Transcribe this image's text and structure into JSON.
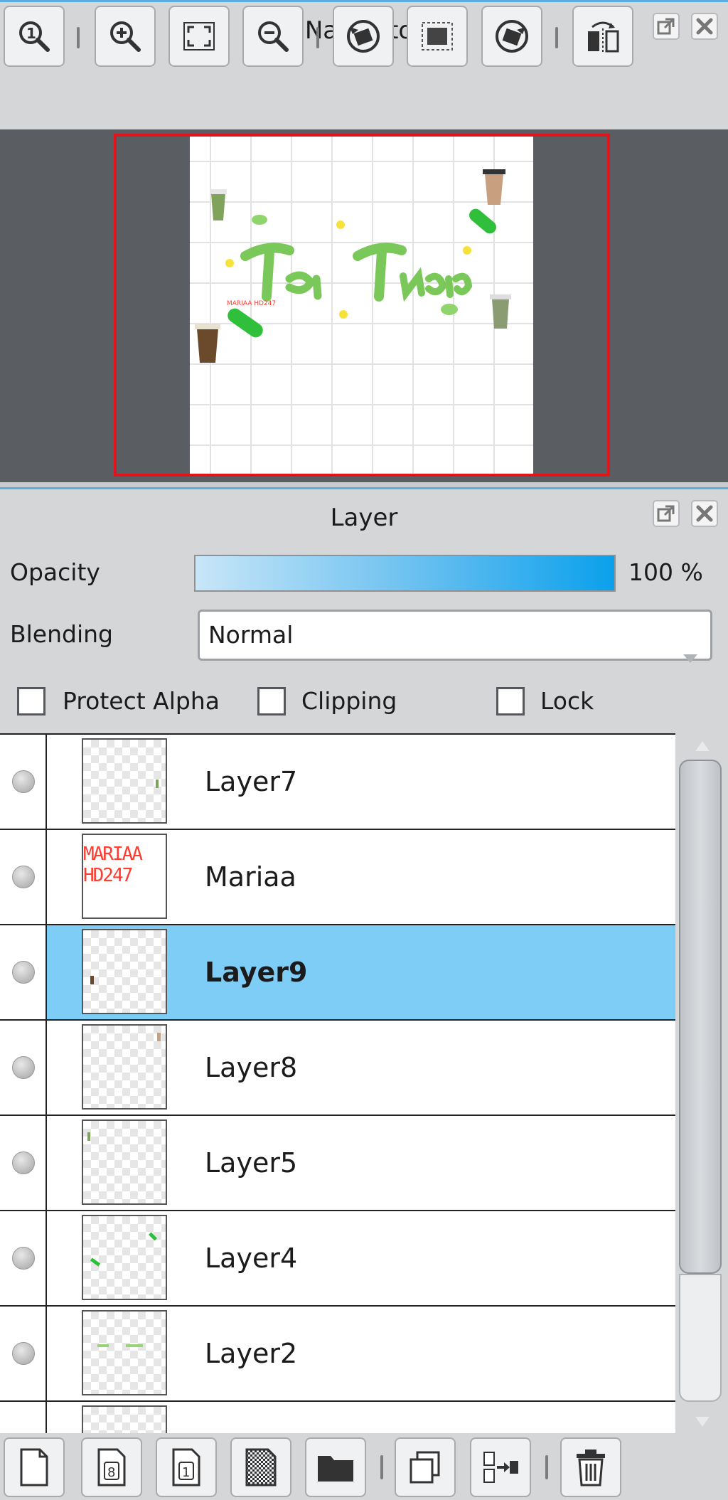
{
  "navigator": {
    "title": "Navigator",
    "canvas_watermark": "MARIAA HD247"
  },
  "layer_panel": {
    "title": "Layer",
    "opacity_label": "Opacity",
    "opacity_value": "100 %",
    "opacity_fraction": 1.0,
    "blending_label": "Blending",
    "blending_value": "Normal",
    "protect_alpha_label": "Protect Alpha",
    "clipping_label": "Clipping",
    "lock_label": "Lock",
    "layers": [
      {
        "name": "Layer7"
      },
      {
        "name": "Mariaa",
        "thumb_text": "MARIAA HD247"
      },
      {
        "name": "Layer9",
        "selected": true
      },
      {
        "name": "Layer8"
      },
      {
        "name": "Layer5"
      },
      {
        "name": "Layer4"
      },
      {
        "name": "Layer2"
      }
    ]
  },
  "colors": {
    "accent_blue": "#5aaee0",
    "selection": "#7dcdf6",
    "frame_red": "#e0141a",
    "watermark_red": "#ff3b2f"
  },
  "icons": {
    "navigator_toolbar": [
      "zoom-actual-size-icon",
      "zoom-in-icon",
      "fit-to-window-icon",
      "zoom-out-icon",
      "rotate-left-icon",
      "reset-rotation-icon",
      "rotate-right-icon",
      "flip-horizontal-icon"
    ],
    "layer_toolbar": [
      "new-color-layer-icon",
      "new-8bit-layer-icon",
      "new-1bit-layer-icon",
      "new-halftone-layer-icon",
      "new-folder-icon",
      "duplicate-layer-icon",
      "merge-down-icon",
      "delete-layer-icon"
    ]
  }
}
